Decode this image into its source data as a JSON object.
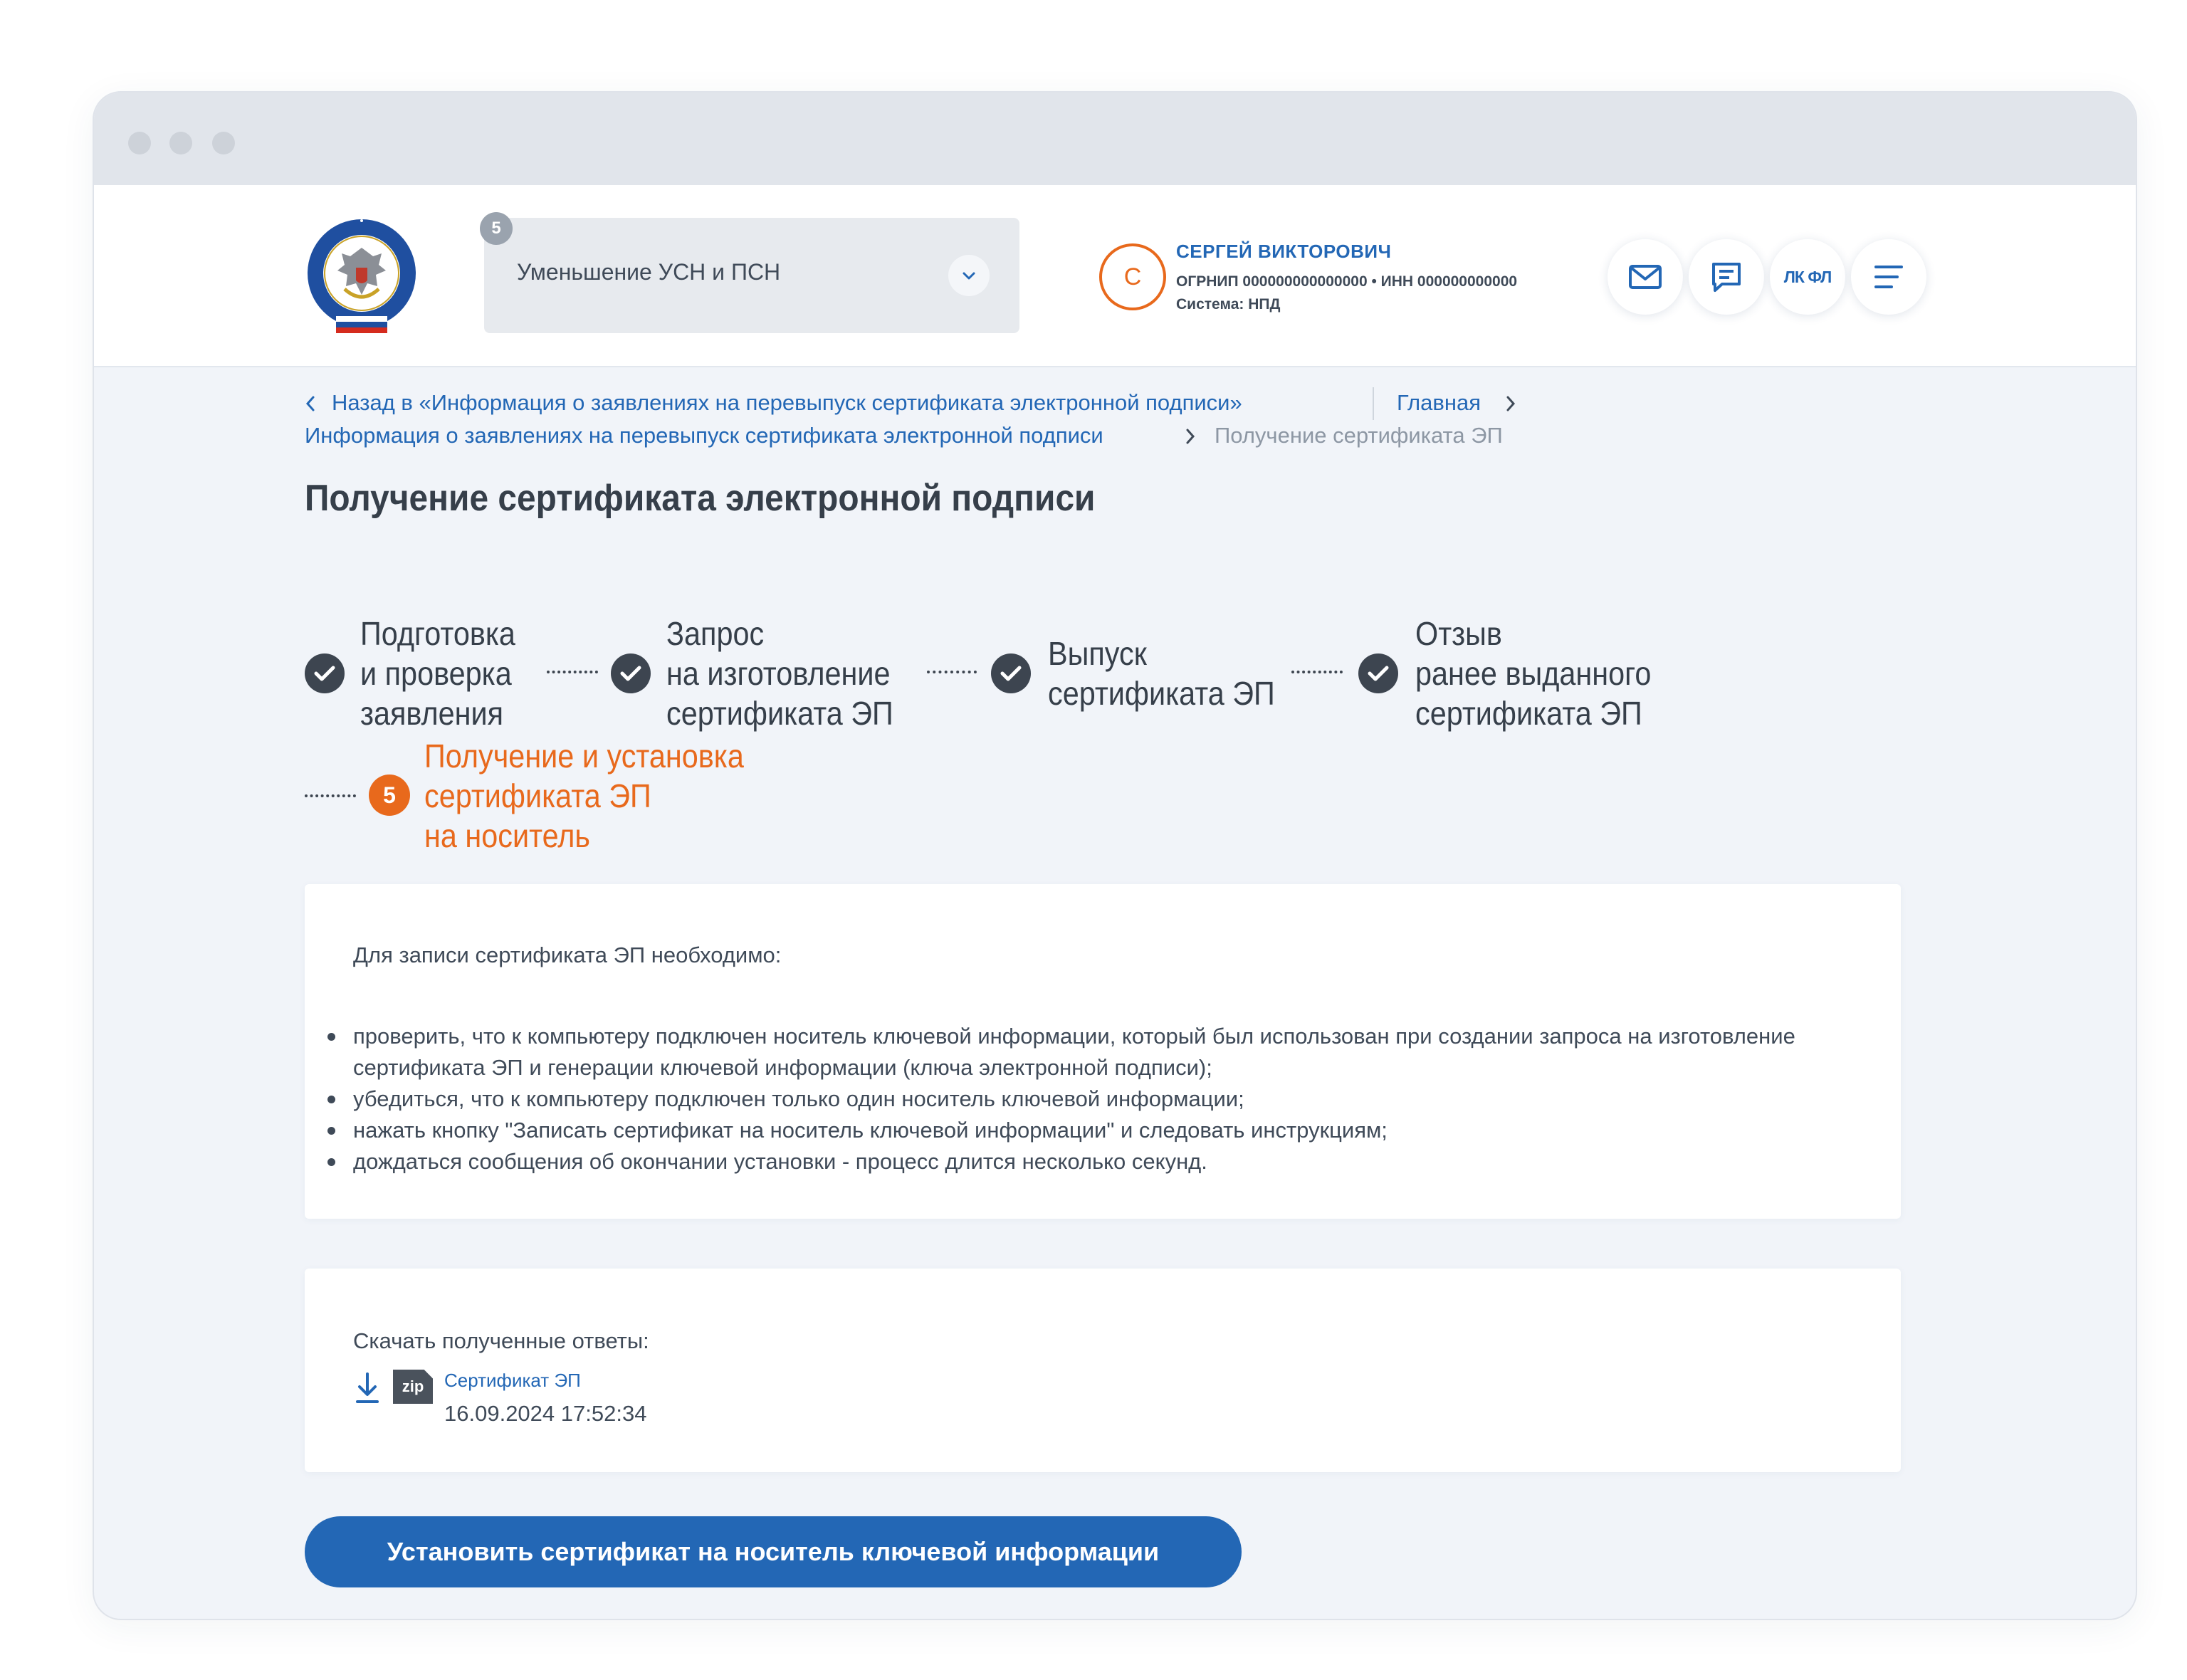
{
  "header": {
    "service_select": {
      "badge": "5",
      "value": "Уменьшение УСН и ПСН"
    },
    "user": {
      "avatar_letter": "С",
      "name": "СЕРГЕЙ ВИКТОРОВИЧ",
      "ogrnip": "ОГРНИП 000000000000000 •  ИНН 000000000000",
      "system": "Система: НПД"
    },
    "buttons": {
      "lk_label": "ЛК ФЛ"
    }
  },
  "breadcrumbs": {
    "back_link": "Назад в «Информация о заявлениях на перевыпуск сертификата электронной подписи»",
    "home_link": "Главная",
    "parent_link": "Информация о заявлениях на перевыпуск сертификата электронной подписи",
    "current": "Получение сертификата ЭП"
  },
  "page_title": "Получение сертификата электронной подписи",
  "steps": [
    {
      "lines": [
        "Подготовка",
        "и проверка",
        "заявления"
      ],
      "status": "done"
    },
    {
      "lines": [
        "Запрос",
        "на изготовление",
        "сертификата ЭП"
      ],
      "status": "done"
    },
    {
      "lines": [
        "Выпуск",
        "сертификата ЭП"
      ],
      "status": "done"
    },
    {
      "lines": [
        "Отзыв",
        "ранее выданного",
        "сертификата ЭП"
      ],
      "status": "done"
    },
    {
      "number": "5",
      "lines": [
        "Получение и установка",
        "сертификата ЭП",
        "на носитель"
      ],
      "status": "active"
    }
  ],
  "instructions": {
    "intro": "Для записи сертификата ЭП необходимо:",
    "items": [
      "проверить, что к компьютеру подключен носитель ключевой информации, который был использован при создании запроса на изготовление сертификата ЭП и генерации ключевой информации (ключа электронной подписи);",
      "убедиться, что к компьютеру подключен только один носитель ключевой информации;",
      "нажать кнопку \"Записать сертификат на носитель ключевой информации\" и следовать инструкциям;",
      "дождаться сообщения об окончании установки - процесс длится несколько секунд."
    ]
  },
  "downloads": {
    "title": "Скачать полученные ответы:",
    "file": {
      "type": "zip",
      "name": "Сертификат ЭП",
      "date": "16.09.2024 17:52:34"
    }
  },
  "install_button": "Установить сертификат на носитель ключевой информации",
  "colors": {
    "brand_blue": "#2367b5",
    "accent_orange": "#e8691c",
    "page_bg": "#f1f4f9"
  }
}
